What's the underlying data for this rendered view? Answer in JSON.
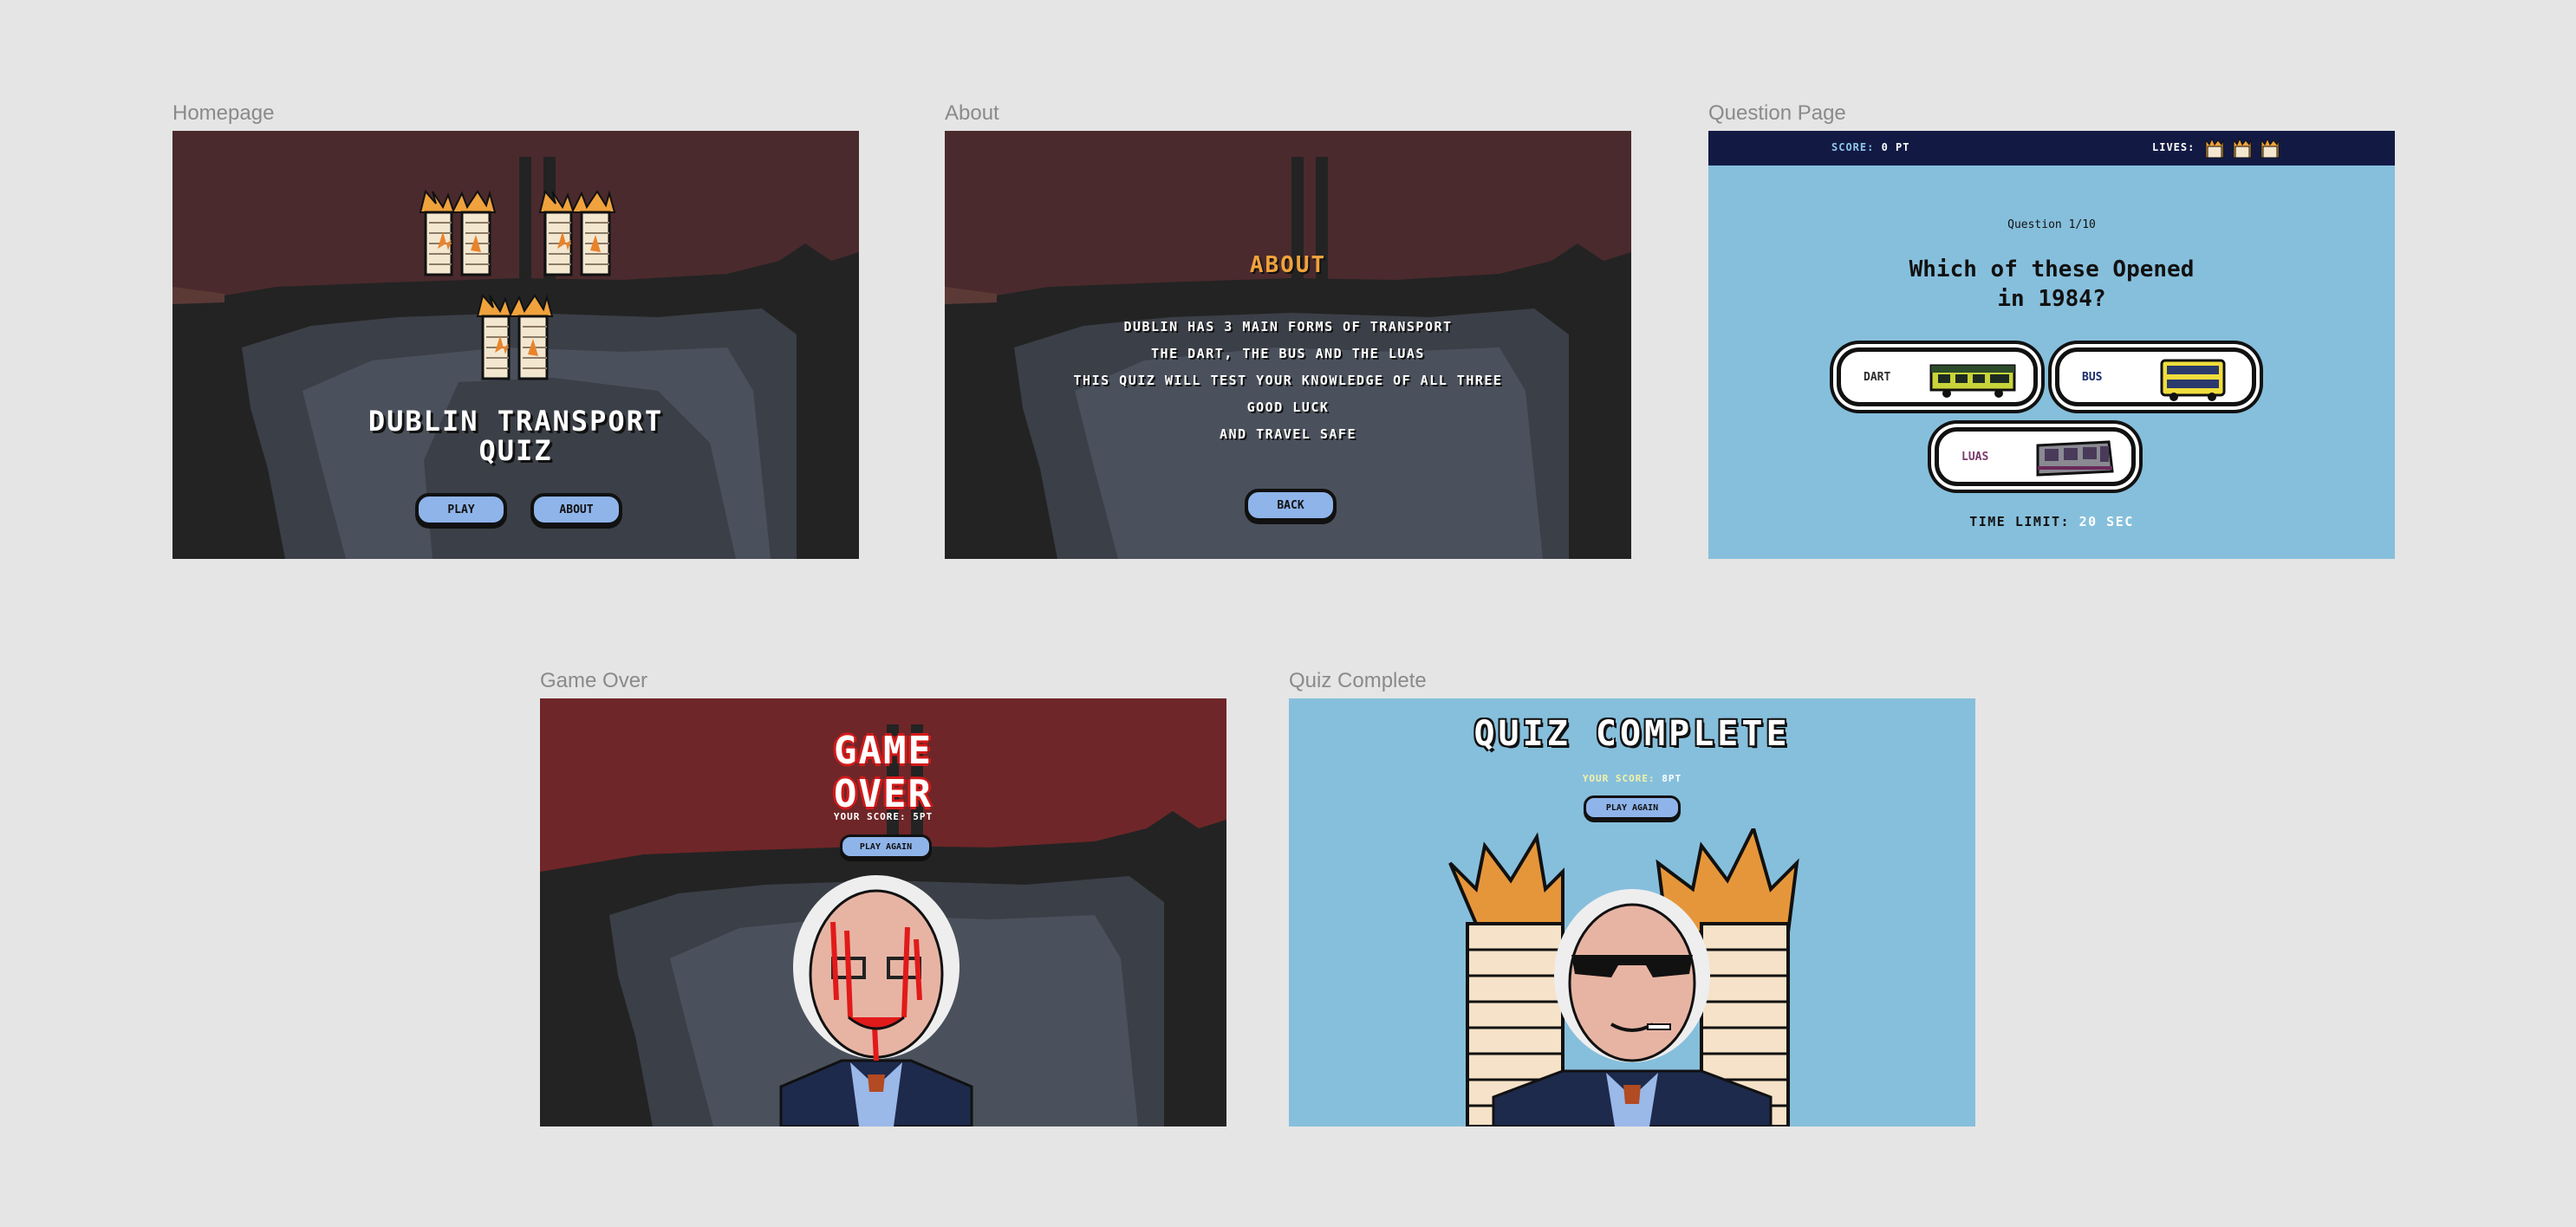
{
  "canvas": {
    "background": "#e5e5e5"
  },
  "frames": {
    "home": {
      "label": "Homepage",
      "title_line1": "DUBLIN TRANSPORT",
      "title_line2": "QUIZ",
      "play_label": "PLAY",
      "about_label": "ABOUT"
    },
    "about": {
      "label": "About",
      "heading": "ABOUT",
      "lines": [
        "DUBLIN HAS 3 MAIN FORMS OF TRANSPORT",
        "THE DART, THE BUS AND THE LUAS",
        "THIS QUIZ WILL TEST YOUR KNOWLEDGE OF ALL THREE",
        "GOOD LUCK",
        "AND TRAVEL SAFE"
      ],
      "back_label": "BACK"
    },
    "question": {
      "label": "Question Page",
      "score_label": "SCORE:",
      "score_value": "0 PT",
      "lives_label": "LIVES:",
      "counter": "Question 1/10",
      "question_line1": "Which of these Opened",
      "question_line2": "in 1984?",
      "answers": [
        "DART",
        "BUS",
        "LUAS"
      ],
      "time_label": "TIME LIMIT:",
      "time_value": "20 SEC"
    },
    "gameover": {
      "label": "Game Over",
      "title_line1": "GAME",
      "title_line2": "OVER",
      "score_text": "YOUR SCORE: 5PT",
      "play_again_label": "PLAY AGAIN"
    },
    "complete": {
      "label": "Quiz Complete",
      "title": "QUIZ COMPLETE",
      "score_label": "YOUR SCORE:",
      "score_value": "8PT",
      "play_again_label": "PLAY AGAIN"
    }
  },
  "colors": {
    "maroon_sky": "#4a2a2d",
    "red_sky": "#6f2628",
    "dark_ground": "#232323",
    "mid_ground": "#3b3f47",
    "light_ground": "#4a515c",
    "orange_heading": "#f0a23c",
    "pill_blue": "#8fb4ea",
    "navy_bar": "#121a44",
    "quiz_blue": "#86bfdc",
    "score_blue": "#8fc6e8",
    "luas_purple": "#7a3a6a"
  },
  "icons": [
    "burning-tower-icon",
    "dart-train-icon",
    "bus-icon",
    "luas-tram-icon",
    "life-tower-icon",
    "politician-portrait"
  ]
}
